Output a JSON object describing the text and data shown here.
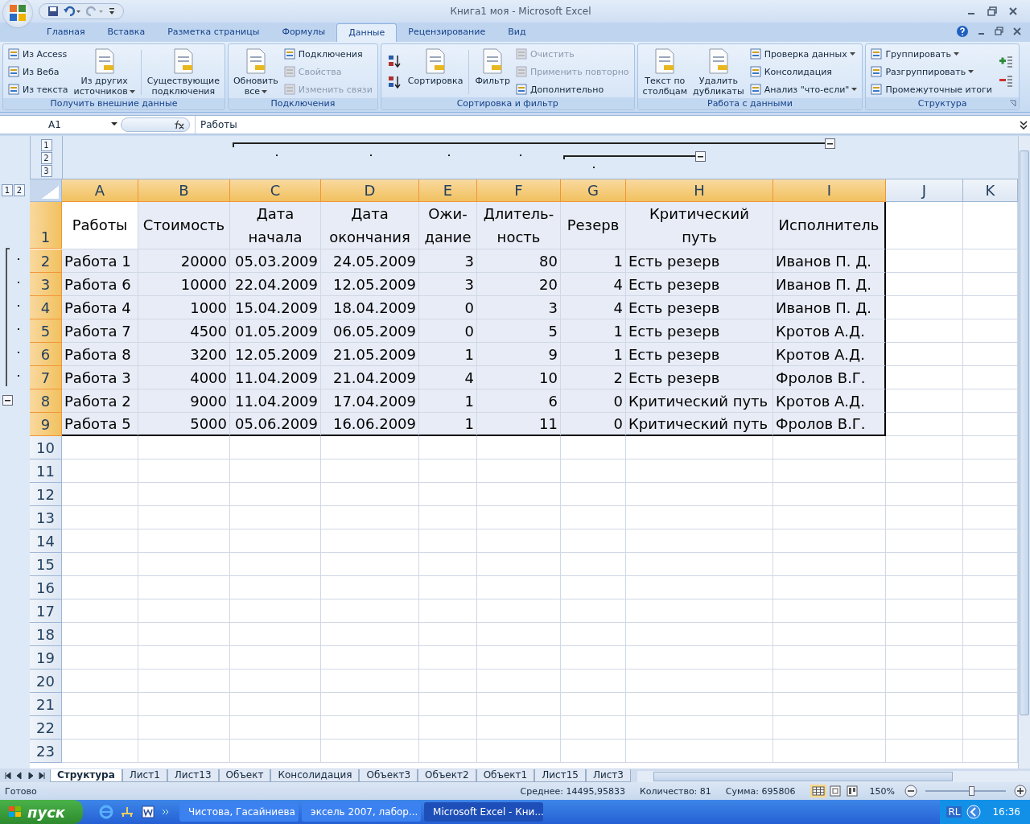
{
  "window": {
    "title": "Книга1 моя - Microsoft Excel"
  },
  "ribbon": {
    "tabs": [
      {
        "label": "Главная",
        "selected": false
      },
      {
        "label": "Вставка",
        "selected": false
      },
      {
        "label": "Разметка страницы",
        "selected": false
      },
      {
        "label": "Формулы",
        "selected": false
      },
      {
        "label": "Данные",
        "selected": true
      },
      {
        "label": "Рецензирование",
        "selected": false
      },
      {
        "label": "Вид",
        "selected": false
      }
    ],
    "groups": [
      {
        "label": "Получить внешние данные",
        "items": [
          {
            "kind": "stack",
            "entries": [
              {
                "label": "Из Access",
                "disabled": false,
                "dropdown": false
              },
              {
                "label": "Из Веба",
                "disabled": false,
                "dropdown": false
              },
              {
                "label": "Из текста",
                "disabled": false,
                "dropdown": false
              }
            ]
          },
          {
            "kind": "large",
            "label": "Из других\nисточников",
            "dropdown": true
          },
          {
            "kind": "separator"
          },
          {
            "kind": "large",
            "label": "Существующие\nподключения",
            "dropdown": false
          }
        ]
      },
      {
        "label": "Подключения",
        "items": [
          {
            "kind": "large",
            "label": "Обновить\nвсе",
            "dropdown": true
          },
          {
            "kind": "stack",
            "entries": [
              {
                "label": "Подключения",
                "disabled": false,
                "dropdown": false
              },
              {
                "label": "Свойства",
                "disabled": true,
                "dropdown": false
              },
              {
                "label": "Изменить связи",
                "disabled": true,
                "dropdown": false
              }
            ]
          }
        ]
      },
      {
        "label": "Сортировка и фильтр",
        "items": [
          {
            "kind": "sort_icons"
          },
          {
            "kind": "large",
            "label": "Сортировка",
            "dropdown": false
          },
          {
            "kind": "separator"
          },
          {
            "kind": "large",
            "label": "Фильтр",
            "dropdown": false
          },
          {
            "kind": "stack",
            "entries": [
              {
                "label": "Очистить",
                "disabled": true,
                "dropdown": false
              },
              {
                "label": "Применить повторно",
                "disabled": true,
                "dropdown": false
              },
              {
                "label": "Дополнительно",
                "disabled": false,
                "dropdown": false
              }
            ]
          }
        ]
      },
      {
        "label": "Работа с данными",
        "items": [
          {
            "kind": "large",
            "label": "Текст по\nстолбцам",
            "dropdown": false
          },
          {
            "kind": "large",
            "label": "Удалить\nдубликаты",
            "dropdown": false
          },
          {
            "kind": "stack",
            "entries": [
              {
                "label": "Проверка данных",
                "disabled": false,
                "dropdown": true
              },
              {
                "label": "Консолидация",
                "disabled": false,
                "dropdown": false
              },
              {
                "label": "Анализ \"что-если\"",
                "disabled": false,
                "dropdown": true
              }
            ]
          }
        ]
      },
      {
        "label": "Структура",
        "items": [
          {
            "kind": "stack",
            "entries": [
              {
                "label": "Группировать",
                "disabled": false,
                "dropdown": true
              },
              {
                "label": "Разгруппировать",
                "disabled": false,
                "dropdown": true
              },
              {
                "label": "Промежуточные итоги",
                "disabled": false,
                "dropdown": false
              }
            ]
          },
          {
            "kind": "detail_icons"
          }
        ]
      }
    ]
  },
  "formula_bar": {
    "name_box": "A1",
    "value": "Работы"
  },
  "outline": {
    "column_levels": [
      "1",
      "2",
      "3"
    ],
    "row_levels": [
      "1",
      "2"
    ]
  },
  "columns": [
    {
      "letter": "A",
      "kind": "text",
      "selected": true
    },
    {
      "letter": "B",
      "kind": "number",
      "selected": true
    },
    {
      "letter": "C",
      "kind": "number",
      "selected": true
    },
    {
      "letter": "D",
      "kind": "number",
      "selected": true
    },
    {
      "letter": "E",
      "kind": "number",
      "selected": true
    },
    {
      "letter": "F",
      "kind": "number",
      "selected": true
    },
    {
      "letter": "G",
      "kind": "number",
      "selected": true
    },
    {
      "letter": "H",
      "kind": "text",
      "selected": true
    },
    {
      "letter": "I",
      "kind": "text",
      "selected": true
    },
    {
      "letter": "J",
      "kind": "text",
      "selected": false
    },
    {
      "letter": "K",
      "kind": "text",
      "selected": false
    }
  ],
  "rows": [
    {
      "number": "1",
      "selected": true,
      "kind": "header",
      "cells": [
        "Работы",
        "Стоимость",
        "Дата\nначала",
        "Дата\nокончания",
        "Ожи-\nдание",
        "Длитель-\nность",
        "Резерв",
        "Критический\nпуть",
        "Исполнитель"
      ]
    },
    {
      "number": "2",
      "selected": true,
      "kind": "data",
      "cells": [
        "Работа 1",
        "20000",
        "05.03.2009",
        "24.05.2009",
        "3",
        "80",
        "1",
        "Есть резерв",
        "Иванов П. Д."
      ]
    },
    {
      "number": "3",
      "selected": true,
      "kind": "data",
      "cells": [
        "Работа 6",
        "10000",
        "22.04.2009",
        "12.05.2009",
        "3",
        "20",
        "4",
        "Есть резерв",
        "Иванов П. Д."
      ]
    },
    {
      "number": "4",
      "selected": true,
      "kind": "data",
      "cells": [
        "Работа 4",
        "1000",
        "15.04.2009",
        "18.04.2009",
        "0",
        "3",
        "4",
        "Есть резерв",
        "Иванов П. Д."
      ]
    },
    {
      "number": "5",
      "selected": true,
      "kind": "data",
      "cells": [
        "Работа 7",
        "4500",
        "01.05.2009",
        "06.05.2009",
        "0",
        "5",
        "1",
        "Есть резерв",
        "Кротов А.Д."
      ]
    },
    {
      "number": "6",
      "selected": true,
      "kind": "data",
      "cells": [
        "Работа 8",
        "3200",
        "12.05.2009",
        "21.05.2009",
        "1",
        "9",
        "1",
        "Есть резерв",
        "Кротов А.Д."
      ]
    },
    {
      "number": "7",
      "selected": true,
      "kind": "data",
      "cells": [
        "Работа 3",
        "4000",
        "11.04.2009",
        "21.04.2009",
        "4",
        "10",
        "2",
        "Есть резерв",
        "Фролов В.Г."
      ]
    },
    {
      "number": "8",
      "selected": true,
      "kind": "data",
      "cells": [
        "Работа 2",
        "9000",
        "11.04.2009",
        "17.04.2009",
        "1",
        "6",
        "0",
        "Критический путь",
        "Кротов А.Д."
      ]
    },
    {
      "number": "9",
      "selected": true,
      "kind": "data",
      "cells": [
        "Работа 5",
        "5000",
        "05.06.2009",
        "16.06.2009",
        "1",
        "11",
        "0",
        "Критический путь",
        "Фролов В.Г."
      ]
    },
    {
      "number": "10",
      "selected": false,
      "kind": "data"
    },
    {
      "number": "11",
      "selected": false,
      "kind": "data"
    },
    {
      "number": "12",
      "selected": false,
      "kind": "data"
    },
    {
      "number": "13",
      "selected": false,
      "kind": "data"
    },
    {
      "number": "14",
      "selected": false,
      "kind": "data"
    },
    {
      "number": "15",
      "selected": false,
      "kind": "data"
    },
    {
      "number": "16",
      "selected": false,
      "kind": "data"
    },
    {
      "number": "17",
      "selected": false,
      "kind": "data"
    },
    {
      "number": "18",
      "selected": false,
      "kind": "data"
    },
    {
      "number": "19",
      "selected": false,
      "kind": "data"
    },
    {
      "number": "20",
      "selected": false,
      "kind": "data"
    },
    {
      "number": "21",
      "selected": false,
      "kind": "data"
    },
    {
      "number": "22",
      "selected": false,
      "kind": "data"
    },
    {
      "number": "23",
      "selected": false,
      "kind": "data"
    }
  ],
  "sheet_tabs": [
    {
      "label": "Структура",
      "selected": true
    },
    {
      "label": "Лист1",
      "selected": false
    },
    {
      "label": "Лист13",
      "selected": false
    },
    {
      "label": "Объект",
      "selected": false
    },
    {
      "label": "Консолидация",
      "selected": false
    },
    {
      "label": "Объект3",
      "selected": false
    },
    {
      "label": "Объект2",
      "selected": false
    },
    {
      "label": "Объект1",
      "selected": false
    },
    {
      "label": "Лист15",
      "selected": false
    },
    {
      "label": "Лист3",
      "selected": false
    }
  ],
  "status_bar": {
    "state": "Готово",
    "stats": [
      "Среднее: 14495,95833",
      "Количество: 81",
      "Сумма: 695806"
    ],
    "zoom": "150%",
    "zoom_slider": {
      "level": 0.57
    }
  },
  "taskbar": {
    "start": "пуск",
    "tasks": [
      {
        "label": "Чистова, Гасайниева",
        "selected": false
      },
      {
        "label": "эксель  2007, лабор...",
        "selected": false
      },
      {
        "label": "Microsoft Excel - Кни...",
        "selected": true
      }
    ],
    "tray": "RL",
    "clock": "16:36"
  }
}
